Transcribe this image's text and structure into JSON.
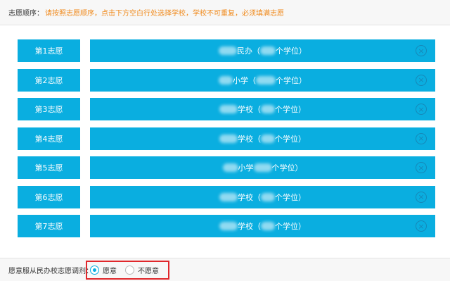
{
  "header": {
    "label": "志愿顺序：",
    "hint": "请按照志愿顺序，点击下方空白行处选择学校，学校不可重复，必须填满志愿"
  },
  "choices": [
    {
      "tag": "第1志愿",
      "school_pre": "民办（",
      "school_suf": "个学位）"
    },
    {
      "tag": "第2志愿",
      "school_pre": "小学（",
      "school_suf": "个学位）"
    },
    {
      "tag": "第3志愿",
      "school_pre": "学校（",
      "school_suf": "个学位）"
    },
    {
      "tag": "第4志愿",
      "school_pre": "学校（",
      "school_suf": "个学位）"
    },
    {
      "tag": "第5志愿",
      "school_pre": "小学",
      "school_suf": "个学位）"
    },
    {
      "tag": "第6志愿",
      "school_pre": "学校（",
      "school_suf": "个学位）"
    },
    {
      "tag": "第7志愿",
      "school_pre": "学校（",
      "school_suf": "个学位）"
    }
  ],
  "clear_icon": "close-circle-icon",
  "footer": {
    "question": "愿意服从民办校志愿调剂：",
    "options": [
      {
        "label": "愿意",
        "selected": true
      },
      {
        "label": "不愿意",
        "selected": false
      }
    ]
  },
  "colors": {
    "accent": "#0aaee0",
    "hint": "#f08a1c",
    "highlight": "#e0272b"
  }
}
